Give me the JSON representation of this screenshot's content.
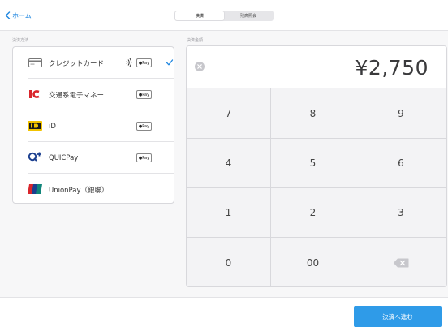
{
  "header": {
    "back_label": "ホーム",
    "tabs": [
      {
        "label": "決済",
        "active": true
      },
      {
        "label": "残高照会",
        "active": false
      }
    ]
  },
  "payment_methods": {
    "section_label": "決済方法",
    "items": [
      {
        "label": "クレジットカード",
        "icon": "credit-card-icon",
        "contactless": true,
        "apple_pay": "Pay",
        "selected": true
      },
      {
        "label": "交通系電子マネー",
        "icon": "ic-transit-icon",
        "contactless": false,
        "apple_pay": "Pay",
        "selected": false
      },
      {
        "label": "iD",
        "icon": "id-logo-icon",
        "contactless": false,
        "apple_pay": "Pay",
        "selected": false
      },
      {
        "label": "QUICPay",
        "icon": "quicpay-logo-icon",
        "contactless": false,
        "apple_pay": "Pay",
        "selected": false
      },
      {
        "label": "UnionPay（銀聯）",
        "icon": "unionpay-logo-icon",
        "contactless": false,
        "apple_pay": null,
        "selected": false
      }
    ]
  },
  "amount": {
    "section_label": "決済金額",
    "value": "¥2,750"
  },
  "keypad": {
    "keys": [
      "7",
      "8",
      "9",
      "4",
      "5",
      "6",
      "1",
      "2",
      "3",
      "0",
      "00",
      ""
    ]
  },
  "footer": {
    "proceed_label": "決済へ進む"
  },
  "colors": {
    "accent": "#1e86e0",
    "button": "#2f9be8",
    "idlogo_bg": "#f2c300",
    "ic_red": "#d9262c"
  }
}
